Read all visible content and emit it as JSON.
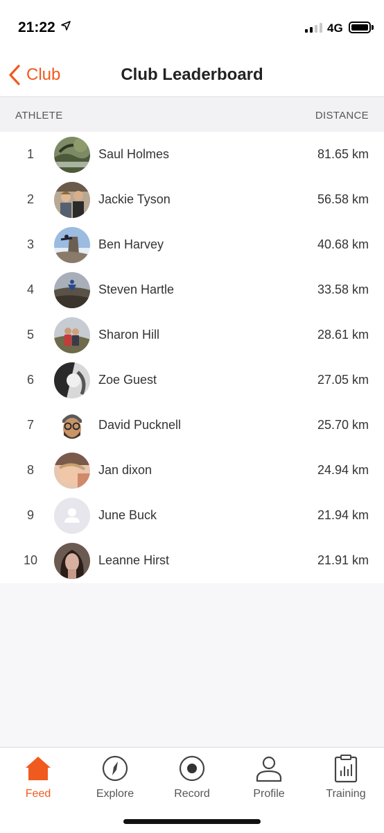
{
  "status_bar": {
    "time": "21:22",
    "network": "4G"
  },
  "nav": {
    "back_label": "Club",
    "title": "Club Leaderboard"
  },
  "columns": {
    "athlete": "ATHLETE",
    "distance": "DISTANCE"
  },
  "entries": [
    {
      "rank": "1",
      "name": "Saul Holmes",
      "distance": "81.65 km",
      "avatar": "landscape-photo"
    },
    {
      "rank": "2",
      "name": "Jackie Tyson",
      "distance": "56.58 km",
      "avatar": "couple-photo"
    },
    {
      "rank": "3",
      "name": "Ben Harvey",
      "distance": "40.68 km",
      "avatar": "rock-climb-photo"
    },
    {
      "rank": "4",
      "name": "Steven Hartle",
      "distance": "33.58 km",
      "avatar": "hill-jump-photo"
    },
    {
      "rank": "5",
      "name": "Sharon Hill",
      "distance": "28.61 km",
      "avatar": "runners-photo"
    },
    {
      "rank": "6",
      "name": "Zoe Guest",
      "distance": "27.05 km",
      "avatar": "bw-photo"
    },
    {
      "rank": "7",
      "name": "David Pucknell",
      "distance": "25.70 km",
      "avatar": "memoji"
    },
    {
      "rank": "8",
      "name": "Jan dixon",
      "distance": "24.94 km",
      "avatar": "selfie-photo"
    },
    {
      "rank": "9",
      "name": "June Buck",
      "distance": "21.94 km",
      "avatar": "default-person-icon"
    },
    {
      "rank": "10",
      "name": "Leanne Hirst",
      "distance": "21.91 km",
      "avatar": "portrait-photo"
    }
  ],
  "tabs": [
    {
      "label": "Feed",
      "icon": "home-icon",
      "active": true
    },
    {
      "label": "Explore",
      "icon": "compass-icon",
      "active": false
    },
    {
      "label": "Record",
      "icon": "record-icon",
      "active": false
    },
    {
      "label": "Profile",
      "icon": "profile-icon",
      "active": false
    },
    {
      "label": "Training",
      "icon": "training-icon",
      "active": false
    }
  ],
  "colors": {
    "accent": "#f05a1e",
    "text": "#333333",
    "header_bg": "#f2f2f5"
  }
}
